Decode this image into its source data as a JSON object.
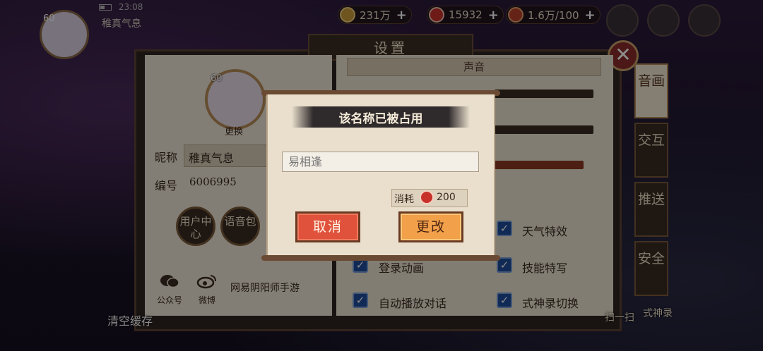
{
  "status_bar": {
    "time": "23:08"
  },
  "top_bar": {
    "player_name": "稚真气息",
    "player_level": "60",
    "resources": [
      {
        "icon": "gold-coin-icon",
        "value": "231万"
      },
      {
        "icon": "magatama-icon",
        "value": "15932"
      },
      {
        "icon": "stamina-icon",
        "value": "1.6万/100"
      }
    ]
  },
  "settings_panel": {
    "title": "设置",
    "close_symbol": "✕",
    "profile": {
      "level": "60",
      "change_label": "更换",
      "nickname_label": "昵称",
      "nickname_value": "稚真气息",
      "id_label": "编号",
      "id_value": "6006995"
    },
    "circle_buttons": [
      "用户中心",
      "语音包"
    ],
    "share": [
      {
        "icon": "wechat-icon",
        "label": "公众号"
      },
      {
        "icon": "weibo-icon",
        "label": "微博"
      }
    ],
    "publisher": "网易阴阳师手游",
    "sound_section": "声音",
    "checkboxes": [
      {
        "label": "天气特效",
        "checked": true
      },
      {
        "label": "登录动画",
        "checked": true
      },
      {
        "label": "技能特写",
        "checked": true
      },
      {
        "label": "自动播放对话",
        "checked": true
      },
      {
        "label": "式神录切换",
        "checked": true
      }
    ],
    "tabs": [
      {
        "label": "音画",
        "active": true
      },
      {
        "label": "交互",
        "active": false
      },
      {
        "label": "推送",
        "active": false
      },
      {
        "label": "安全",
        "active": false
      }
    ]
  },
  "bottom": {
    "clear_cache": "清空缓存",
    "scan": "扫一扫",
    "shikigami": "式神录"
  },
  "dialog": {
    "title": "该名称已被占用",
    "input_placeholder": "易相逢",
    "cost_label": "消耗",
    "cost_value": "200",
    "cancel_label": "取消",
    "confirm_label": "更改"
  }
}
